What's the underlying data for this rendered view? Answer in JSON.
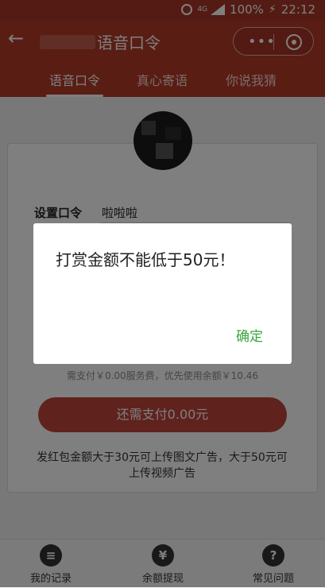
{
  "status_bar": {
    "network": "4G",
    "battery": "100%",
    "time": "22:12"
  },
  "header": {
    "title": "语音口令"
  },
  "tabs": [
    {
      "label": "语音口令"
    },
    {
      "label": "真心寄语"
    },
    {
      "label": "你说我猜"
    }
  ],
  "form": {
    "password_label": "设置口令",
    "password_value": "啦啦啦"
  },
  "fee_note": "需支付￥0.00服务费，优先使用余额￥10.46",
  "pay_button": "还需支付0.00元",
  "ad_note": "发红包金额大于30元可上传图文广告，大于50元可上传视频广告",
  "bottom_nav": [
    {
      "label": "我的记录",
      "icon": "list-icon"
    },
    {
      "label": "余额提现",
      "icon": "yen-icon"
    },
    {
      "label": "常见问题",
      "icon": "question-icon"
    }
  ],
  "dialog": {
    "message": "打赏金额不能低于50元！",
    "confirm": "确定"
  },
  "colors": {
    "header": "#b33a29",
    "button": "#c0453a",
    "confirm": "#3aa53a"
  }
}
